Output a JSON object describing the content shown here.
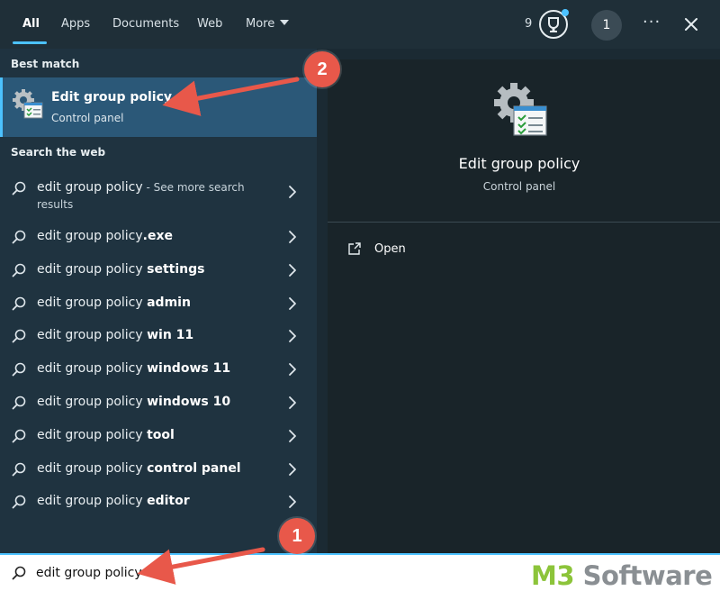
{
  "tabs": [
    {
      "label": "All",
      "active": true
    },
    {
      "label": "Apps"
    },
    {
      "label": "Documents"
    },
    {
      "label": "Web"
    },
    {
      "label": "More"
    }
  ],
  "header": {
    "points": "9",
    "avatar_initial": "1",
    "more_options": "···"
  },
  "left": {
    "best_match_label": "Best match",
    "best_match": {
      "title": "Edit group policy",
      "subtitle": "Control panel",
      "icon": "group-policy-icon"
    },
    "search_web_label": "Search the web",
    "first_result": {
      "prefix": "edit group policy",
      "suffix": " - See more search",
      "wrap": "results"
    },
    "results": [
      {
        "prefix": "edit group policy",
        "bold": ".exe"
      },
      {
        "prefix": "edit group policy ",
        "bold": "settings"
      },
      {
        "prefix": "edit group policy ",
        "bold": "admin"
      },
      {
        "prefix": "edit group policy ",
        "bold": "win 11"
      },
      {
        "prefix": "edit group policy ",
        "bold": "windows 11"
      },
      {
        "prefix": "edit group policy ",
        "bold": "windows 10"
      },
      {
        "prefix": "edit group policy ",
        "bold": "tool"
      },
      {
        "prefix": "edit group policy ",
        "bold": "control panel"
      },
      {
        "prefix": "edit group policy ",
        "bold": "editor"
      }
    ]
  },
  "right": {
    "title": "Edit group policy",
    "subtitle": "Control panel",
    "open_label": "Open"
  },
  "search": {
    "value": "edit group policy"
  },
  "watermark": {
    "part1": "M3",
    "part2": " Software"
  },
  "annotations": {
    "step1": "1",
    "step2": "2"
  },
  "colors": {
    "accent": "#4cc2ff",
    "badge": "#e8584a",
    "selected": "#2b5878"
  }
}
